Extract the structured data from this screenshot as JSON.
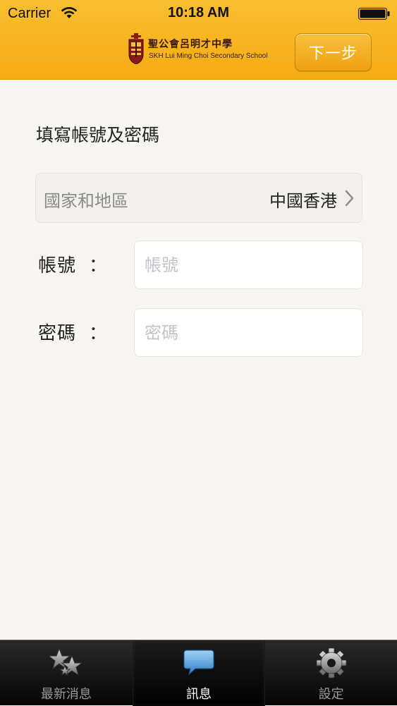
{
  "status_bar": {
    "carrier": "Carrier",
    "time": "10:18 AM"
  },
  "header": {
    "school_name_zh": "聖公會呂明才中學",
    "school_name_en": "SKH Lui Ming Choi Secondary School",
    "next_label": "下一步",
    "bg_color": "#f7b11f"
  },
  "form": {
    "title": "填寫帳號及密碼",
    "region": {
      "label": "國家和地區",
      "value": "中國香港"
    },
    "account": {
      "label": "帳號",
      "colon": "：",
      "placeholder": "帳號",
      "value": ""
    },
    "password": {
      "label": "密碼",
      "colon": "：",
      "placeholder": "密碼",
      "value": ""
    }
  },
  "tab_bar": {
    "tabs": [
      {
        "label": "最新消息",
        "icon": "stars-icon",
        "active": false
      },
      {
        "label": "訊息",
        "icon": "speech-bubble-icon",
        "active": true
      },
      {
        "label": "設定",
        "icon": "gear-icon",
        "active": false
      }
    ]
  }
}
